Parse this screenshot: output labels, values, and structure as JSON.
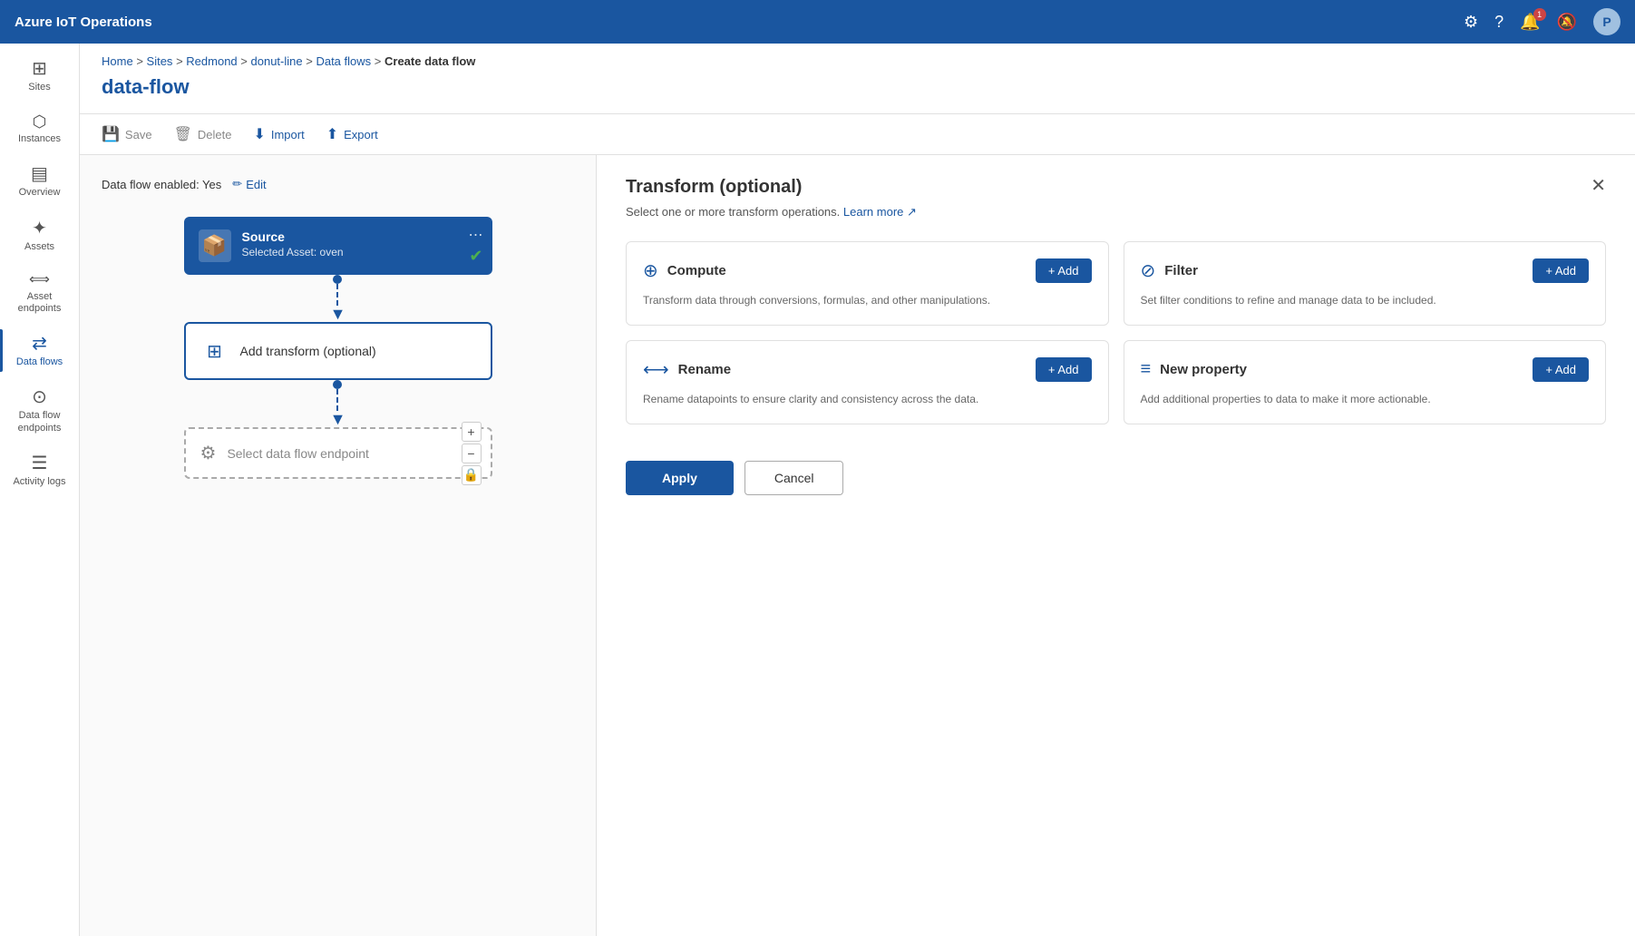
{
  "app": {
    "title": "Azure IoT Operations"
  },
  "topbar": {
    "title": "Azure IoT Operations",
    "avatar_label": "P",
    "notification_count": "1"
  },
  "sidebar": {
    "items": [
      {
        "id": "sites",
        "label": "Sites",
        "icon": "⊞"
      },
      {
        "id": "instances",
        "label": "Instances",
        "icon": "⬡"
      },
      {
        "id": "overview",
        "label": "Overview",
        "icon": "▤"
      },
      {
        "id": "assets",
        "label": "Assets",
        "icon": "✦"
      },
      {
        "id": "asset-endpoints",
        "label": "Asset endpoints",
        "icon": "⟺"
      },
      {
        "id": "data-flows",
        "label": "Data flows",
        "icon": "⇄",
        "active": true
      },
      {
        "id": "data-flow-endpoints",
        "label": "Data flow endpoints",
        "icon": "⊙"
      },
      {
        "id": "activity-logs",
        "label": "Activity logs",
        "icon": "☰"
      }
    ]
  },
  "breadcrumb": {
    "parts": [
      "Home",
      "Sites",
      "Redmond",
      "donut-line",
      "Data flows",
      "Create data flow"
    ]
  },
  "page_title": "data-flow",
  "toolbar": {
    "save_label": "Save",
    "delete_label": "Delete",
    "import_label": "Import",
    "export_label": "Export"
  },
  "flow_enabled": {
    "label": "Data flow enabled: Yes",
    "edit_label": "Edit"
  },
  "source_node": {
    "title": "Source",
    "subtitle": "Selected Asset: oven",
    "menu_icon": "⋯"
  },
  "transform_node": {
    "label": "Add transform (optional)"
  },
  "endpoint_node": {
    "label": "Select data flow endpoint"
  },
  "transform_panel": {
    "title": "Transform (optional)",
    "subtitle": "Select one or more transform operations.",
    "learn_more": "Learn more",
    "close_icon": "✕",
    "operations": [
      {
        "id": "compute",
        "icon": "⊕",
        "title": "Compute",
        "description": "Transform data through conversions, formulas, and other manipulations.",
        "add_label": "+ Add"
      },
      {
        "id": "filter",
        "icon": "⊘",
        "title": "Filter",
        "description": "Set filter conditions to refine and manage data to be included.",
        "add_label": "+ Add"
      },
      {
        "id": "rename",
        "icon": "⟷",
        "title": "Rename",
        "description": "Rename datapoints to ensure clarity and consistency across the data.",
        "add_label": "+ Add"
      },
      {
        "id": "new-property",
        "icon": "≡",
        "title": "New property",
        "description": "Add additional properties to data to make it more actionable.",
        "add_label": "+ Add"
      }
    ],
    "apply_label": "Apply",
    "cancel_label": "Cancel"
  }
}
